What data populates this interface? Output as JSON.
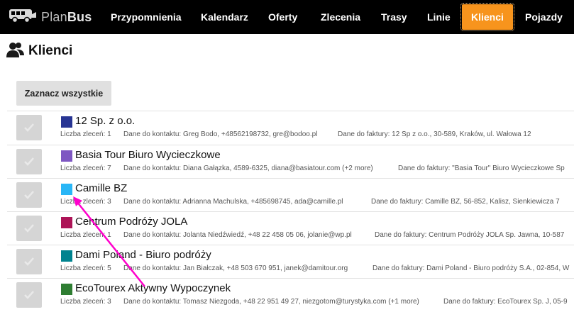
{
  "brand": {
    "light": "Plan",
    "bold": "Bus"
  },
  "nav": {
    "items": [
      {
        "label": "Przypomnienia"
      },
      {
        "label": "Kalendarz"
      },
      {
        "label": "Oferty"
      },
      {
        "label": "Zlecenia"
      },
      {
        "label": "Trasy"
      },
      {
        "label": "Linie"
      },
      {
        "label": "Klienci",
        "active": true
      },
      {
        "label": "Pojazdy"
      }
    ]
  },
  "page": {
    "title": "Klienci",
    "icon": "users-icon"
  },
  "toolbar": {
    "select_all_label": "Zaznacz wszystkie"
  },
  "clients": [
    {
      "name": "12 Sp. z o.o.",
      "color": "#283593",
      "orders": "Liczba zleceń: 1",
      "contact": "Dane do kontaktu: Greg Bodo, +48562198732, gre@bodoo.pl",
      "invoice": "Dane do faktury: 12 Sp z o.o., 30-589, Kraków, ul. Wałowa 12"
    },
    {
      "name": "Basia Tour Biuro Wycieczkowe",
      "color": "#7e57c2",
      "orders": "Liczba zleceń: 7",
      "contact": "Dane do kontaktu: Diana Gałązka, 4589-6325, diana@basiatour.com (+2 more)",
      "invoice": "Dane do faktury: \"Basia Tour\" Biuro Wycieczkowe Sp"
    },
    {
      "name": "Camille BZ",
      "color": "#29b6f6",
      "orders": "Liczba zleceń: 3",
      "contact": "Dane do kontaktu: Adrianna Machulska, +485698745, ada@camille.pl",
      "invoice": "Dane do faktury: Camille BZ, 56-852, Kalisz, Sienkiewicza 7"
    },
    {
      "name": "Centrum Podróży JOLA",
      "color": "#ad1457",
      "orders": "Liczba zleceń: 1",
      "contact": "Dane do kontaktu: Jolanta Niedźwiedź, +48 22 458 05 06, jolanie@wp.pl",
      "invoice": "Dane do faktury: Centrum Podróży JOLA Sp. Jawna, 10-587"
    },
    {
      "name": "Dami Poland - Biuro podróży",
      "color": "#00838f",
      "orders": "Liczba zleceń: 5",
      "contact": "Dane do kontaktu: Jan Białczak, +48 503 670 951, janek@damitour.org",
      "invoice": "Dane do faktury: Dami Poland - Biuro podróży S.A., 02-854, W"
    },
    {
      "name": "EcoTourex Aktywny Wypoczynek",
      "color": "#2e7d32",
      "orders": "Liczba zleceń: 3",
      "contact": "Dane do kontaktu: Tomasz Niezgoda, +48 22 951 49 27, niezgotom@turystyka.com (+1 more)",
      "invoice": "Dane do faktury: EcoTourex Sp. J, 05-9"
    }
  ],
  "colors": {
    "nav_bg": "#000000",
    "accent": "#f7941d",
    "annotation": "#ff00cc"
  }
}
